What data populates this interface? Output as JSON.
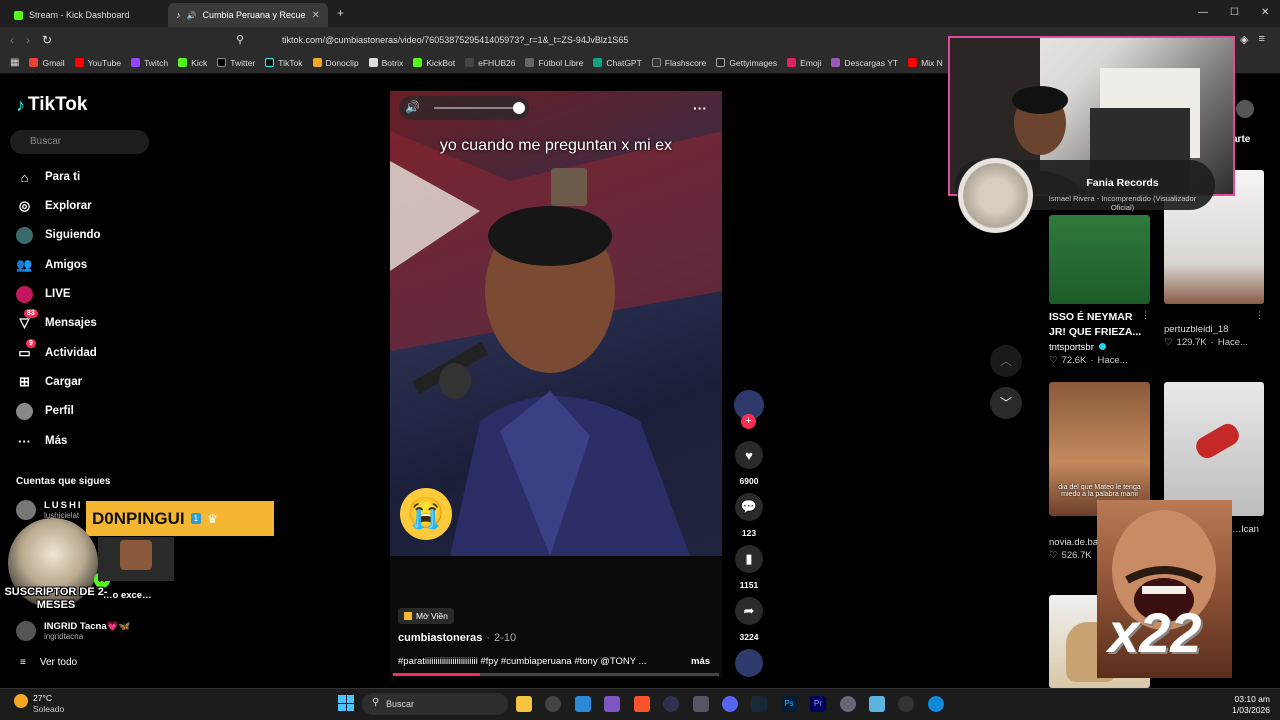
{
  "browser": {
    "tabs": [
      {
        "title": "Stream - Kick Dashboard",
        "active": false
      },
      {
        "title": "Cumbia Peruana y Recuerdos",
        "active": true
      }
    ],
    "url": "tiktok.com/@cumbiastoneras/video/7605387529541405973?_r=1&_t=ZS-94JvBlz1S65",
    "bookmarks": [
      "Gmail",
      "YouTube",
      "Twitch",
      "Kick",
      "Twitter",
      "TikTok",
      "Donoclip",
      "Botrix",
      "KickBot",
      "eFHUB26",
      "Fútbol Libre",
      "ChatGPT",
      "Flashscore",
      "Gettyimages",
      "Emoji",
      "Descargas YT",
      "Mix N"
    ],
    "window_controls": [
      "—",
      "☐",
      "✕"
    ]
  },
  "tiktok": {
    "logo": "TikTok",
    "search_placeholder": "Buscar",
    "nav": [
      {
        "label": "Para ti",
        "icon": "home-icon"
      },
      {
        "label": "Explorar",
        "icon": "compass-icon"
      },
      {
        "label": "Siguiendo",
        "icon": "following-icon"
      },
      {
        "label": "Amigos",
        "icon": "friends-icon"
      },
      {
        "label": "LIVE",
        "icon": "live-icon"
      },
      {
        "label": "Mensajes",
        "icon": "messages-icon",
        "badge": "83"
      },
      {
        "label": "Actividad",
        "icon": "activity-icon",
        "badge": "9"
      },
      {
        "label": "Cargar",
        "icon": "upload-icon"
      },
      {
        "label": "Perfil",
        "icon": "profile-icon"
      },
      {
        "label": "Más",
        "icon": "more-icon"
      }
    ],
    "following_title": "Cuentas que sigues",
    "following": [
      {
        "name": "LUSHI",
        "sub": "lushicielat"
      },
      {
        "name": "…o exce…",
        "sub": ""
      },
      {
        "name": "INGRID Tacna💗🦋",
        "sub": "ingridtacna"
      }
    ],
    "see_all": "Ver todo",
    "video": {
      "caption": "yo cuando  me preguntan x mi  ex",
      "sound_tag": "Mờ Viền",
      "author": "cumbiastoneras",
      "date": "2-10",
      "description": "#paratiiiiiiiiiiiiiiiiiiiiiiiii #fpy #cumbiaperuana #tony @TONY ...",
      "more": "más",
      "likes": "6900",
      "comments": "123",
      "saves": "1151",
      "shares": "3224"
    },
    "grid": [
      {
        "title": "ISSO É NEYMAR JR! QUE FRIEZA...",
        "author": "tntsportsbr",
        "views": "72.6K",
        "time": "Hace..."
      },
      {
        "title": "",
        "author": "pertuzbleidi_18",
        "views": "129.7K",
        "time": "Hace..."
      },
      {
        "title": "",
        "author": "novia.de.ba",
        "views": "526.7K",
        "time": ""
      },
      {
        "title": "",
        "author": "…lcan",
        "views": "",
        "time": ""
      }
    ],
    "grid_overlay_text": "dia del que Mateo le tenga miedo a la palabra mami",
    "share_label": "arte"
  },
  "overlays": {
    "music_artist": "Fania Records",
    "music_track": "Ismael Rivera - Incomprendido (Visualizador Oficial)",
    "donor_name": "D0NPINGUI",
    "donor_level": "1",
    "sub_badge": "SUSCRIPTOR DE 2-MESES",
    "combo": "x22"
  },
  "taskbar": {
    "weather_temp": "27°C",
    "weather_desc": "Soleado",
    "search": "Buscar",
    "time": "03:10 am",
    "date": "1/03/2026"
  }
}
